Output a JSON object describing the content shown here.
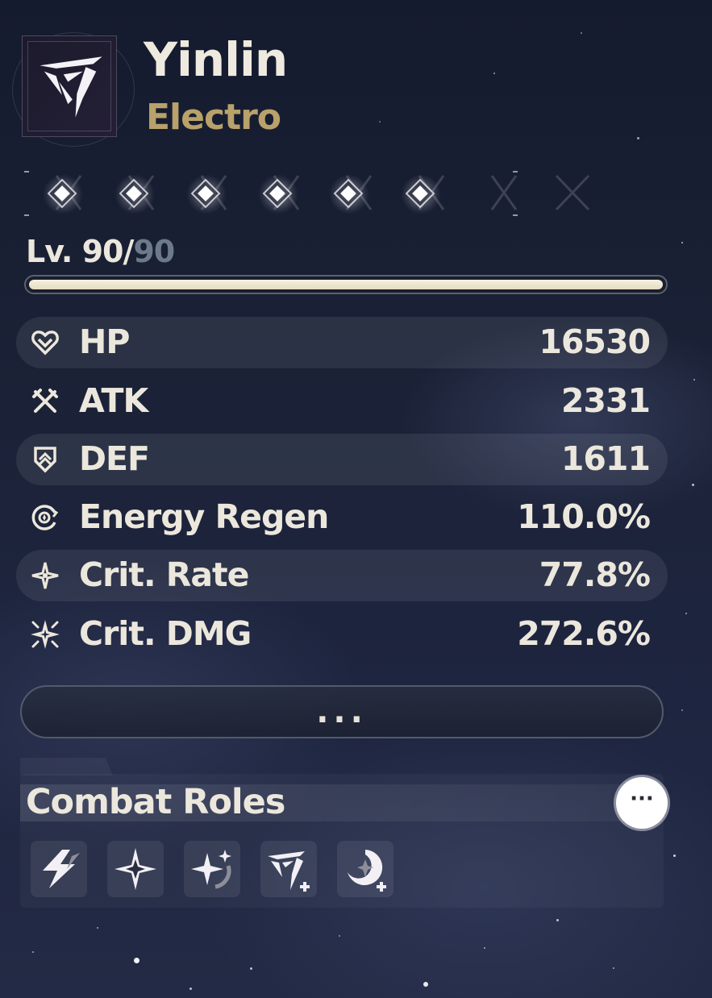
{
  "character": {
    "name": "Yinlin",
    "element": "Electro",
    "emblem_icon": "electro-emblem-icon"
  },
  "sequence": {
    "nodes": 6,
    "active": 6
  },
  "level": {
    "prefix": "Lv. ",
    "current": "90",
    "separator": "/",
    "max": "90",
    "progress": 1.0
  },
  "stats": [
    {
      "label": "HP",
      "value": "16530",
      "icon": "heart-icon"
    },
    {
      "label": "ATK",
      "value": "2331",
      "icon": "crossed-swords-icon"
    },
    {
      "label": "DEF",
      "value": "1611",
      "icon": "shield-icon"
    },
    {
      "label": "Energy Regen",
      "value": "110.0%",
      "icon": "energy-regen-icon"
    },
    {
      "label": "Crit. Rate",
      "value": "77.8%",
      "icon": "crit-rate-icon"
    },
    {
      "label": "Crit. DMG",
      "value": "272.6%",
      "icon": "crit-dmg-icon"
    }
  ],
  "more_button": {
    "label": "..."
  },
  "combat_roles": {
    "title": "Combat Roles",
    "info_label": "···",
    "roles": [
      {
        "icon": "electro-burst-role-icon"
      },
      {
        "icon": "star-burst-role-icon"
      },
      {
        "icon": "sparkle-swirl-role-icon"
      },
      {
        "icon": "emblem-plus-role-icon"
      },
      {
        "icon": "swirl-plus-role-icon"
      }
    ]
  },
  "colors": {
    "accent_gold": "#b8a16a",
    "text": "#ece7dc",
    "level_max": "#6d7a8a"
  }
}
